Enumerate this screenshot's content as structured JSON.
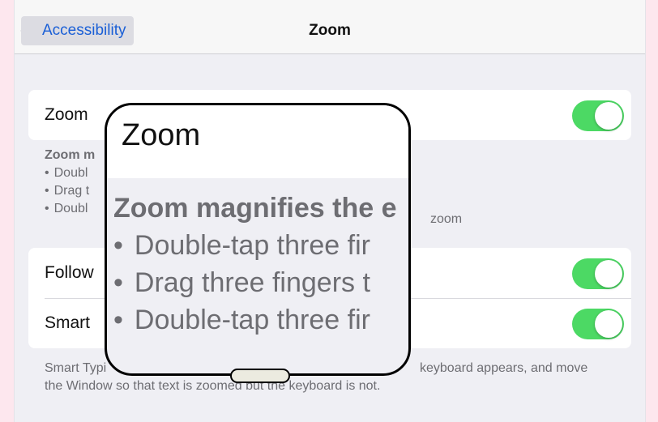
{
  "navbar": {
    "back_label": "Accessibility",
    "title": "Zoom"
  },
  "zoom_group": {
    "zoom_label": "Zoom",
    "zoom_on": true
  },
  "zoom_footer": {
    "title": "Zoom m",
    "items": [
      "Doubl",
      "Drag t",
      "Doubl"
    ],
    "trailing": "zoom"
  },
  "options_group": {
    "follow_label": "Follow",
    "follow_on": true,
    "smart_label": "Smart",
    "smart_on": true
  },
  "smart_footer": {
    "line1_start": "Smart Typi",
    "line1_end": "keyboard appears, and move",
    "line2": "the Window so that text is zoomed but the keyboard is not."
  },
  "zoom_window": {
    "title": "Zoom",
    "desc_title": "Zoom magnifies the e",
    "items": [
      "Double-tap three fir",
      "Drag three fingers t",
      "Double-tap three fir"
    ]
  },
  "colors": {
    "toggle_on": "#4cd964",
    "link": "#1a5fd6",
    "outer_background": "#fde7ee"
  }
}
